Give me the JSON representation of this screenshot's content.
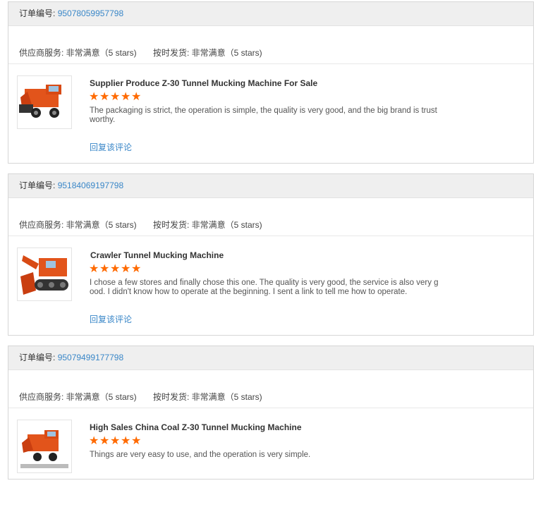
{
  "labels": {
    "order_prefix": "订单编号:",
    "supplier_service": "供应商服务: 非常满意（5 stars)",
    "on_time_delivery": "按时发货: 非常满意（5 stars)",
    "reply": "回复该评论"
  },
  "orders": [
    {
      "order_no": "95078059957798",
      "product_title": "Supplier Produce Z-30 Tunnel Mucking Machine For Sale",
      "rating": 5,
      "comment": "The packaging is strict, the operation is simple, the quality is very good, and the big brand is trustworthy."
    },
    {
      "order_no": "95184069197798",
      "product_title": "Crawler Tunnel Mucking Machine",
      "rating": 5,
      "comment": "I chose a few stores and finally chose this one. The quality is very good, the service is also very good. I didn't know how to operate at the beginning. I sent a link to tell me how to operate."
    },
    {
      "order_no": "95079499177798",
      "product_title": "High Sales China Coal Z-30 Tunnel Mucking Machine",
      "rating": 5,
      "comment": "Things are very easy to use, and the operation is very simple."
    }
  ],
  "colors": {
    "link": "#3a87c8",
    "star": "#ff6a00",
    "machine": "#e2541b"
  }
}
